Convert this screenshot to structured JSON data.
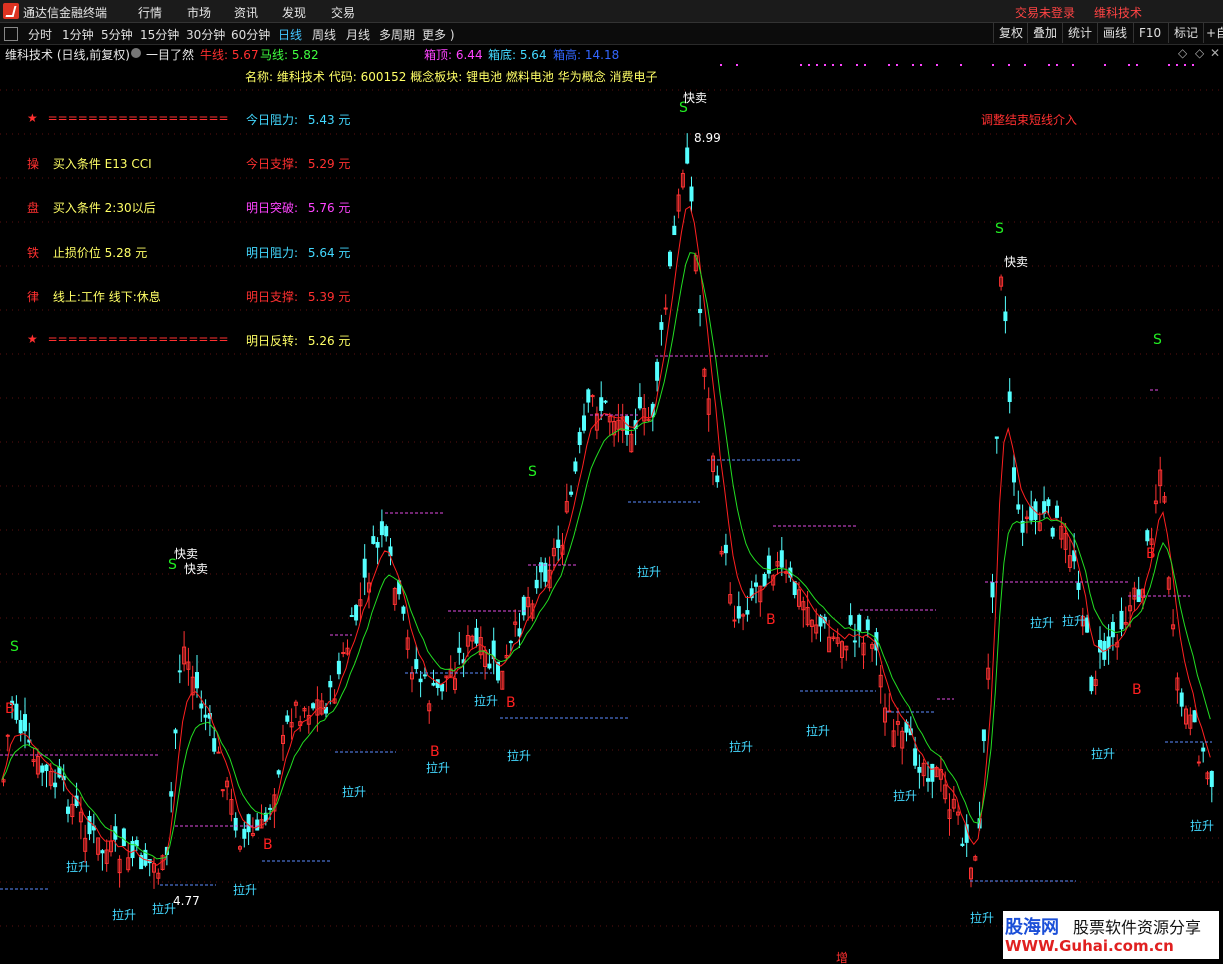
{
  "menubar": {
    "app_title": "通达信金融终端",
    "menus": [
      "行情",
      "市场",
      "资讯",
      "发现",
      "交易"
    ],
    "login": "交易未登录",
    "brand": "维科技术"
  },
  "toolbar": {
    "periods": [
      "分时",
      "1分钟",
      "5分钟",
      "15分钟",
      "30分钟",
      "60分钟",
      "日线",
      "周线",
      "月线",
      "多周期",
      "更多 )"
    ],
    "active_period": "日线",
    "right_buttons": [
      "复权",
      "叠加",
      "统计",
      "画线",
      "F10",
      "标记",
      "+自"
    ]
  },
  "infobar": {
    "title": "维科技术 (日线,前复权)",
    "overview_label": "一目了然",
    "niu_label": "牛线: 5.67",
    "ma_label": "马线: 5.82",
    "box_top": "箱顶: 6.44",
    "box_bottom": "箱底: 5.64",
    "box_high": "箱高: 14.18"
  },
  "info_line": {
    "name_label": "名称:",
    "name": "维科技术",
    "code_label": "代码:",
    "code": "600152",
    "concept_label": "概念板块:",
    "concepts": "锂电池 燃料电池 华为概念 消费电子"
  },
  "left_panel": [
    {
      "mark": "★",
      "text": "==================",
      "color": "#ff3030"
    },
    {
      "mark": "操",
      "text": "买入条件 E13 CCI",
      "color": "#ffff66"
    },
    {
      "mark": "盘",
      "text": "买入条件 2:30以后",
      "color": "#ffff66"
    },
    {
      "mark": "铁",
      "text": "止损价位 5.28 元",
      "color": "#ffff66"
    },
    {
      "mark": "律",
      "text": "线上:工作 线下:休息",
      "color": "#ffff66"
    },
    {
      "mark": "★",
      "text": "==================",
      "color": "#ff3030"
    }
  ],
  "levels": [
    {
      "label": "今日阻力:",
      "value": "5.43 元",
      "color": "#43d9ff"
    },
    {
      "label": "今日支撑:",
      "value": "5.29 元",
      "color": "#ff3030"
    },
    {
      "label": "明日突破:",
      "value": "5.76 元",
      "color": "#ff44ff"
    },
    {
      "label": "明日阻力:",
      "value": "5.64 元",
      "color": "#43d9ff"
    },
    {
      "label": "明日支撑:",
      "value": "5.39 元",
      "color": "#ff3030"
    },
    {
      "label": "明日反转:",
      "value": "5.26 元",
      "color": "#ffff66"
    }
  ],
  "notice": "调整结束短线介入",
  "chart_data": {
    "type": "candlestick",
    "high_label": "8.99",
    "low_label": "4.77",
    "signals": {
      "buy": "B",
      "sell": "S",
      "quick_sell": "快卖",
      "lift": "拉升",
      "increase": "增"
    },
    "colors": {
      "up": "#ff3232",
      "down": "#54ffff",
      "fast_line": "#ff2020",
      "slow_line": "#22dd22",
      "box_top": "#e24de2",
      "box_bottom": "#5b8cff",
      "buy": "#ff2020",
      "sell": "#22ee22"
    }
  },
  "watermark": {
    "logo": "股海网",
    "slogan": "股票软件资源分享",
    "url": "WWW.Guhai.com.cn"
  }
}
